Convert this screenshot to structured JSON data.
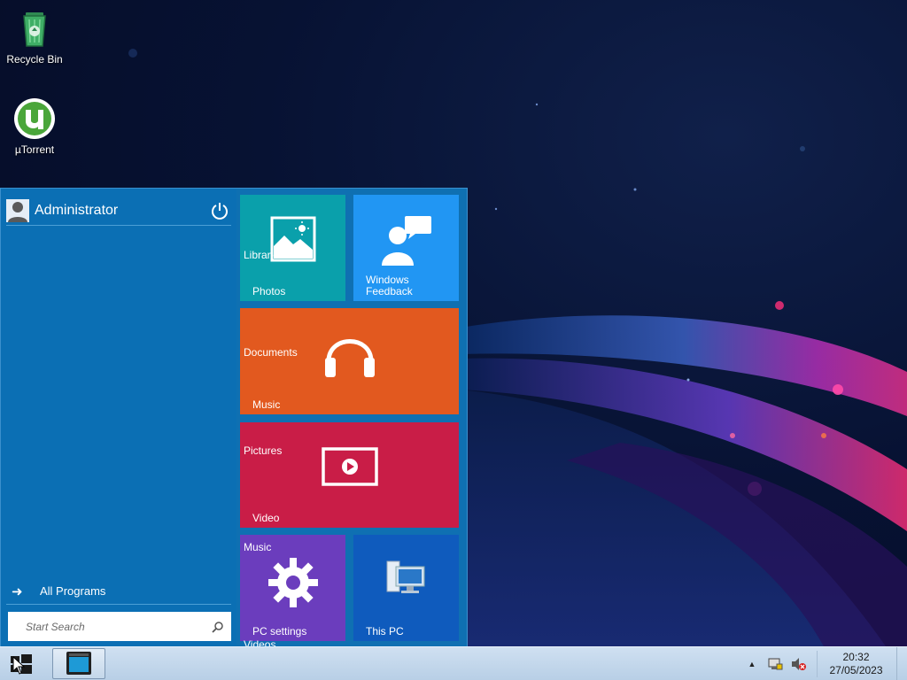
{
  "desktop": {
    "icons": [
      {
        "label": "Recycle Bin",
        "icon": "recycle-bin-icon"
      },
      {
        "label": "µTorrent",
        "icon": "utorrent-icon"
      }
    ]
  },
  "start_menu": {
    "user_name": "Administrator",
    "all_programs_label": "All Programs",
    "search_placeholder": "Start Search",
    "tiles": {
      "photos": {
        "label": "Photos",
        "overlay": "Libraries",
        "color": "#0aa0ab"
      },
      "feedback": {
        "label_line1": "Windows",
        "label_line2": "Feedback",
        "color": "#2196f3"
      },
      "music": {
        "label": "Music",
        "overlay": "Documents",
        "color": "#e2591f"
      },
      "video": {
        "label": "Video",
        "overlay": "Pictures",
        "color": "#c91d47"
      },
      "pc_settings": {
        "label": "PC settings",
        "overlay_top": "Music",
        "overlay_bottom": "Videos",
        "color": "#6b3dbd"
      },
      "this_pc": {
        "label": "This PC",
        "color": "#0f5bbd"
      }
    }
  },
  "taskbar": {
    "clock_time": "20:32",
    "clock_date": "27/05/2023"
  }
}
